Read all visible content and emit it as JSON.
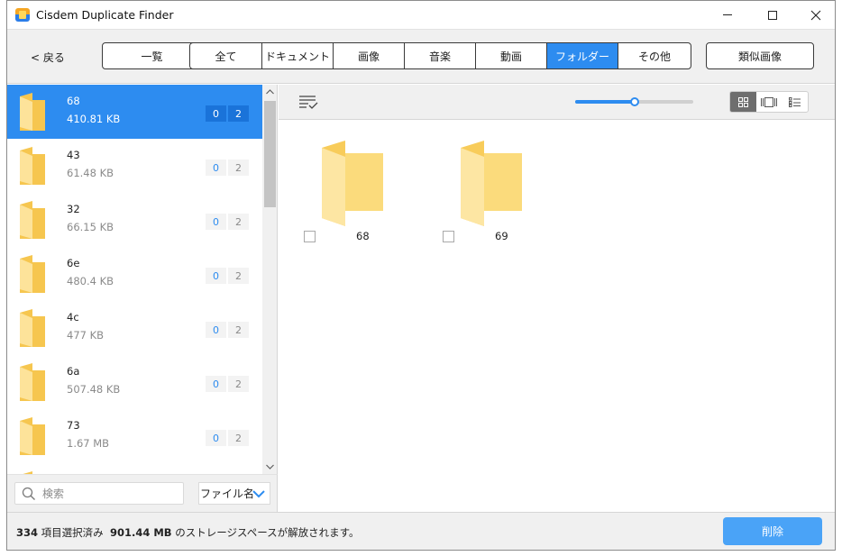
{
  "window": {
    "title": "Cisdem Duplicate Finder"
  },
  "toolbar": {
    "back_label": "< 戻る",
    "list_label": "一覧",
    "tabs": [
      {
        "label": "全て"
      },
      {
        "label": "ドキュメント"
      },
      {
        "label": "画像"
      },
      {
        "label": "音楽"
      },
      {
        "label": "動画"
      },
      {
        "label": "フォルダー"
      },
      {
        "label": "その他"
      }
    ],
    "active_tab": "フォルダー",
    "similar_images_label": "類似画像"
  },
  "sidebar": {
    "items": [
      {
        "name": "68",
        "size": "410.81 KB",
        "count_a": "0",
        "count_b": "2",
        "selected": true
      },
      {
        "name": "43",
        "size": "61.48 KB",
        "count_a": "0",
        "count_b": "2"
      },
      {
        "name": "32",
        "size": "66.15 KB",
        "count_a": "0",
        "count_b": "2"
      },
      {
        "name": "6e",
        "size": "480.4 KB",
        "count_a": "0",
        "count_b": "2"
      },
      {
        "name": "4c",
        "size": "477 KB",
        "count_a": "0",
        "count_b": "2"
      },
      {
        "name": "6a",
        "size": "507.48 KB",
        "count_a": "0",
        "count_b": "2"
      },
      {
        "name": "73",
        "size": "1.67 MB",
        "count_a": "0",
        "count_b": "2"
      }
    ],
    "search": {
      "placeholder": "検索",
      "value": ""
    },
    "sort": {
      "selected": "ファイル名"
    }
  },
  "content": {
    "zoom_level": 0.5,
    "view_mode": "grid",
    "tiles": [
      {
        "name": "68",
        "checked": false
      },
      {
        "name": "69",
        "checked": false
      }
    ]
  },
  "status": {
    "selected_count": "334",
    "selected_label": "項目選択済み",
    "freed_size": "901.44 MB",
    "freed_suffix": "のストレージスペースが解放されます。",
    "delete_label": "削除"
  },
  "colors": {
    "accent": "#2d8cf0",
    "delete_button": "#4aa3f7",
    "folder": "#fcd66a"
  },
  "icons": {
    "app": "app-logo-icon",
    "search": "search-icon",
    "sort": "sort-list-icon",
    "folder": "folder-icon",
    "dropdown": "chevron-down-icon"
  }
}
